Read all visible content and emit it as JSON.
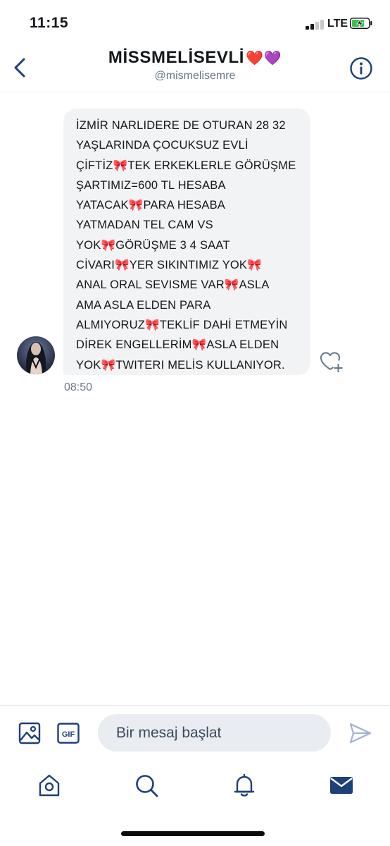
{
  "status_bar": {
    "time": "11:15",
    "network": "LTE",
    "signal_bars_active": 2,
    "signal_bars_total": 4,
    "battery_charging": true
  },
  "header": {
    "display_name": "MİSSMELİSEVLİ",
    "name_emoji": "❤️💜",
    "handle": "@mismelisemre",
    "back_icon": "chevron-left-icon",
    "info_icon": "info-circle-icon"
  },
  "message": {
    "lines": [
      "İZMİR NARLIDERE DE OTURAN 28 32",
      "YAŞLARINDA ÇOCUKSUZ EVLİ",
      "ÇİFTİZ🎀TEK ERKEKLERLE GÖRÜŞME",
      "ŞARTIMIZ=600 TL HESABA",
      "YATACAK🎀PARA HESABA",
      "YATMADAN TEL CAM VS",
      "YOK🎀GÖRÜŞME 3 4 SAAT",
      "CİVARI🎀YER SIKINTIMIZ YOK🎀",
      "ANAL ORAL SEVISME VAR🎀ASLA",
      "AMA ASLA ELDEN PARA",
      "ALMIYORUZ🎀TEKLİF DAHİ ETMEYİN",
      "DİREK ENGELLERİM🎀ASLA ELDEN",
      "YOK🎀TWITERI MELİS KULLANIYOR."
    ],
    "time": "08:50",
    "like_icon": "heart-plus-icon"
  },
  "composer": {
    "placeholder": "Bir mesaj başlat",
    "media_icon": "image-icon",
    "gif_label": "GIF",
    "send_icon": "send-icon"
  },
  "tabbar": {
    "items": [
      {
        "name": "home",
        "icon": "home-icon"
      },
      {
        "name": "search",
        "icon": "search-icon"
      },
      {
        "name": "notifications",
        "icon": "bell-icon"
      },
      {
        "name": "messages",
        "icon": "envelope-icon",
        "active": true
      }
    ]
  },
  "colors": {
    "accent": "#1d3f7a",
    "bubble": "#f1f3f5",
    "secondary_text": "#657786",
    "input_bg": "#e9edf2",
    "send_inactive": "#9fb3cf"
  }
}
